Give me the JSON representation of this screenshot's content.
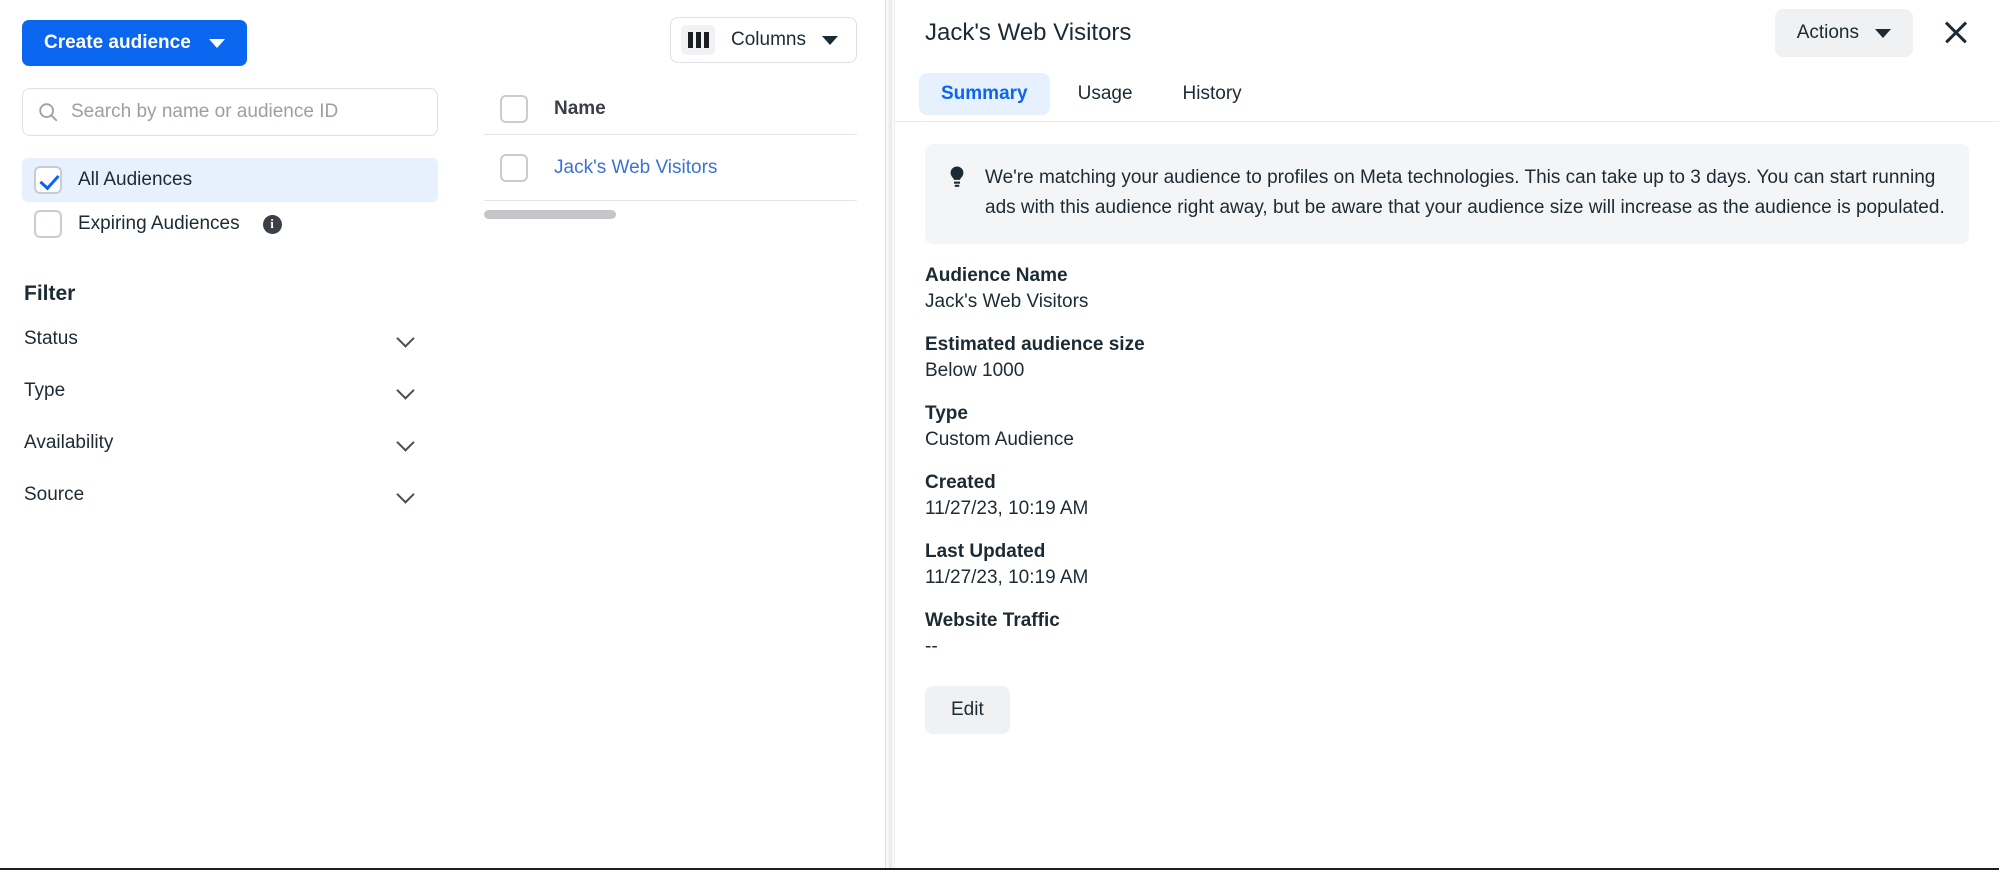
{
  "sidebar": {
    "create_button": {
      "label": "Create audience"
    },
    "search": {
      "placeholder": "Search by name or audience ID",
      "value": ""
    },
    "audience_scopes": [
      {
        "label": "All Audiences",
        "checked": true
      },
      {
        "label": "Expiring Audiences",
        "checked": false,
        "has_info": true
      }
    ],
    "filter_title": "Filter",
    "filters": [
      {
        "label": "Status"
      },
      {
        "label": "Type"
      },
      {
        "label": "Availability"
      },
      {
        "label": "Source"
      }
    ]
  },
  "table": {
    "columns_button": {
      "label": "Columns"
    },
    "headers": [
      "Name"
    ],
    "rows": [
      {
        "name": "Jack's Web Visitors",
        "selected": false
      }
    ]
  },
  "panel": {
    "title": "Jack's Web Visitors",
    "actions_button": {
      "label": "Actions"
    },
    "close_label": "Close",
    "tabs": [
      {
        "label": "Summary",
        "active": true
      },
      {
        "label": "Usage",
        "active": false
      },
      {
        "label": "History",
        "active": false
      }
    ],
    "banner": {
      "icon": "lightbulb-icon",
      "text": "We're matching your audience to profiles on Meta technologies. This can take up to 3 days. You can start running ads with this audience right away, but be aware that your audience size will increase as the audience is populated."
    },
    "fields": [
      {
        "label": "Audience Name",
        "value": "Jack's Web Visitors"
      },
      {
        "label": "Estimated audience size",
        "value": "Below 1000"
      },
      {
        "label": "Type",
        "value": "Custom Audience"
      },
      {
        "label": "Created",
        "value": "11/27/23, 10:19 AM"
      },
      {
        "label": "Last Updated",
        "value": "11/27/23, 10:19 AM"
      },
      {
        "label": "Website Traffic",
        "value": "--"
      }
    ],
    "edit_button": {
      "label": "Edit"
    }
  },
  "colors": {
    "accent_blue": "#0a66ef",
    "link_blue": "#3b72d9",
    "tab_active_bg": "#e7f0fd",
    "selected_row_bg": "#e7f0fd",
    "banner_bg": "#f4f5f6",
    "button_grey": "#f0f1f2",
    "text": "#1c2b33"
  }
}
